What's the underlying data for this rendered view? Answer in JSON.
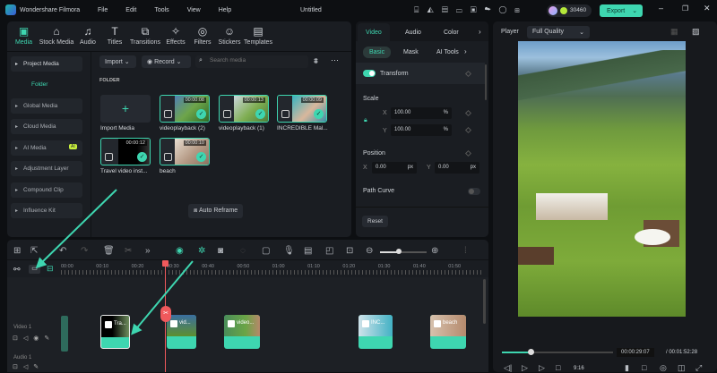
{
  "app": {
    "name": "Wondershare Filmora",
    "menu": [
      "File",
      "Edit",
      "Tools",
      "View",
      "Help"
    ],
    "project_title": "Untitled",
    "credits": "30460",
    "export_label": "Export"
  },
  "toolbar": [
    {
      "label": "Media",
      "icon": "▣"
    },
    {
      "label": "Stock Media",
      "icon": "⌂"
    },
    {
      "label": "Audio",
      "icon": "♫"
    },
    {
      "label": "Titles",
      "icon": "T"
    },
    {
      "label": "Transitions",
      "icon": "⧉"
    },
    {
      "label": "Effects",
      "icon": "✧"
    },
    {
      "label": "Filters",
      "icon": "◎"
    },
    {
      "label": "Stickers",
      "icon": "☺"
    },
    {
      "label": "Templates",
      "icon": "▤"
    }
  ],
  "sidebar": {
    "items": [
      "Project Media",
      "Folder",
      "Global Media",
      "Cloud Media",
      "AI Media",
      "Adjustment Layer",
      "Compound Clip",
      "Influence Kit"
    ],
    "ai_badge": "AI"
  },
  "media": {
    "import_label": "Import",
    "record_label": "Record",
    "search_placeholder": "Search media",
    "folder_heading": "FOLDER",
    "import_media_label": "Import Media",
    "auto_reframe_label": "Auto Reframe",
    "items": [
      {
        "name": "videoplayback (2)",
        "duration": "00:00:08"
      },
      {
        "name": "videoplayback (1)",
        "duration": "00:00:13"
      },
      {
        "name": "INCREDIBLE Mal...",
        "duration": "00:00:09"
      },
      {
        "name": "Travel video inst...",
        "duration": "00:00:12"
      },
      {
        "name": "beach",
        "duration": "00:00:10"
      }
    ]
  },
  "properties": {
    "tabs": [
      "Video",
      "Audio",
      "Color"
    ],
    "subtabs": [
      "Basic",
      "Mask",
      "AI Tools"
    ],
    "transform_label": "Transform",
    "transform_on": true,
    "scale_label": "Scale",
    "scale_x": "100.00",
    "scale_y": "100.00",
    "percent": "%",
    "position_label": "Position",
    "pos_x": "0.00",
    "pos_y": "0.00",
    "px": "px",
    "x": "X",
    "y": "Y",
    "path_curve_label": "Path Curve",
    "path_curve_on": false,
    "reset_label": "Reset"
  },
  "player": {
    "label": "Player",
    "quality": "Full Quality",
    "current_time": "00:00:29:07",
    "total_time": "/ 00:01:52:28",
    "progress": 0.26,
    "ratio": "9:16"
  },
  "timeline": {
    "ruler": [
      "00:00",
      "00:10",
      "00:20",
      "00:30",
      "00:40",
      "00:50",
      "01:00",
      "01:10",
      "01:20",
      "01:30",
      "01:40",
      "01:50"
    ],
    "tracks": [
      "Video 1",
      "Audio 1"
    ],
    "clips": [
      "Tra...",
      "vid...",
      "video...",
      "INC...",
      "beach"
    ],
    "zoom_level": 0.4
  },
  "colors": {
    "accent": "#3ed6b0",
    "playhead": "#f0595c",
    "export": "#3ed6b0"
  }
}
